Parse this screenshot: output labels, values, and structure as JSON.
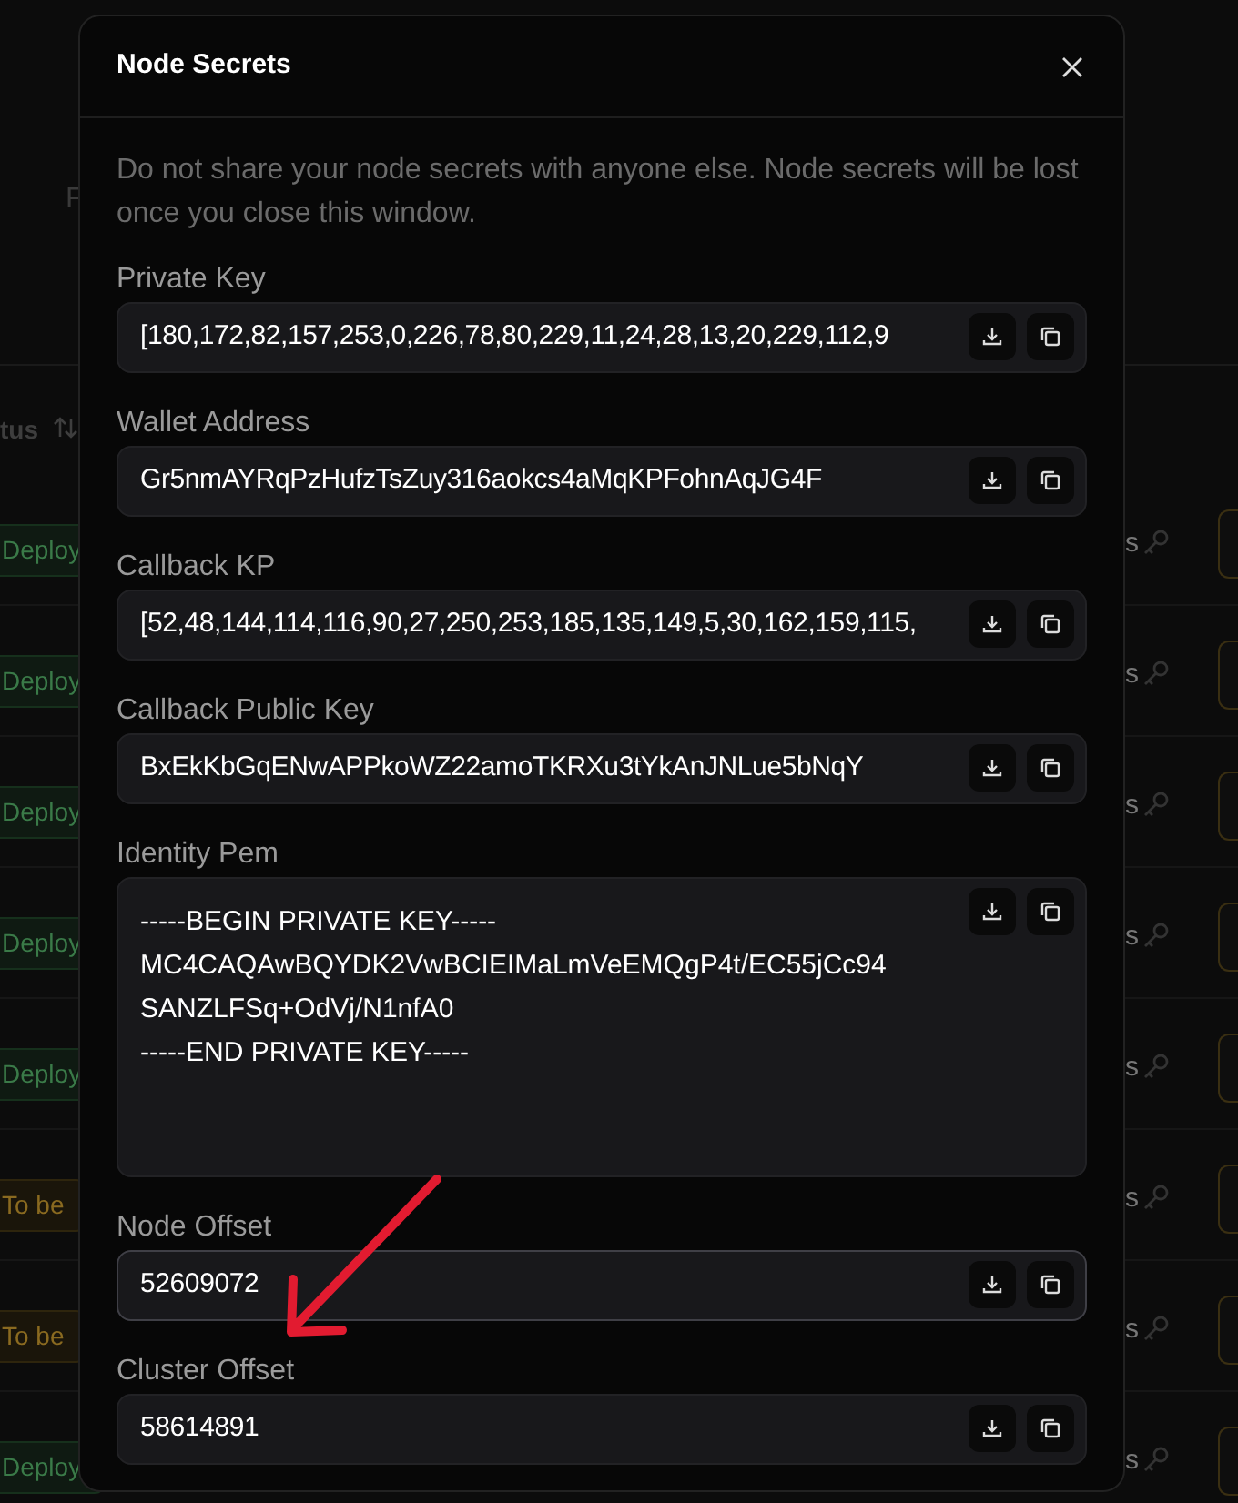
{
  "background": {
    "tab_label": "F",
    "status_header": "tus",
    "rows": [
      {
        "status": "Deploy",
        "kind": "deployed",
        "suffix": "s"
      },
      {
        "status": "Deploy",
        "kind": "deployed",
        "suffix": "s"
      },
      {
        "status": "Deploy",
        "kind": "deployed",
        "suffix": "s"
      },
      {
        "status": "Deploy",
        "kind": "deployed",
        "suffix": "s"
      },
      {
        "status": "Deploy",
        "kind": "deployed",
        "suffix": "s"
      },
      {
        "status": "To be",
        "kind": "pending",
        "suffix": "s"
      },
      {
        "status": "To be",
        "kind": "pending",
        "suffix": "s"
      },
      {
        "status": "Deploy",
        "kind": "deployed",
        "suffix": "s"
      }
    ]
  },
  "dialog": {
    "title": "Node Secrets",
    "description": "Do not share your node secrets with anyone else. Node secrets will be lost once you close this window.",
    "fields": [
      {
        "label": "Private Key",
        "value": "[180,172,82,157,253,0,226,78,80,229,11,24,28,13,20,229,112,9",
        "kind": "line",
        "focused": false
      },
      {
        "label": "Wallet Address",
        "value": "Gr5nmAYRqPzHufzTsZuy316aokcs4aMqKPFohnAqJG4F",
        "kind": "line",
        "focused": false
      },
      {
        "label": "Callback KP",
        "value": "[52,48,144,114,116,90,27,250,253,185,135,149,5,30,162,159,115,",
        "kind": "line",
        "focused": false
      },
      {
        "label": "Callback Public Key",
        "value": "BxEkKbGqENwAPPkoWZ22amoTKRXu3tYkAnJNLue5bNqY",
        "kind": "line",
        "focused": false
      },
      {
        "label": "Identity Pem",
        "value": "-----BEGIN PRIVATE KEY-----\nMC4CAQAwBQYDK2VwBCIEIMaLmVeEMQgP4t/EC55jCc94\nSANZLFSq+OdVj/N1nfA0\n-----END PRIVATE KEY-----",
        "kind": "multiline",
        "focused": false
      },
      {
        "label": "Node Offset",
        "value": "52609072",
        "kind": "line",
        "focused": true
      },
      {
        "label": "Cluster Offset",
        "value": "58614891",
        "kind": "line",
        "focused": false
      }
    ]
  }
}
